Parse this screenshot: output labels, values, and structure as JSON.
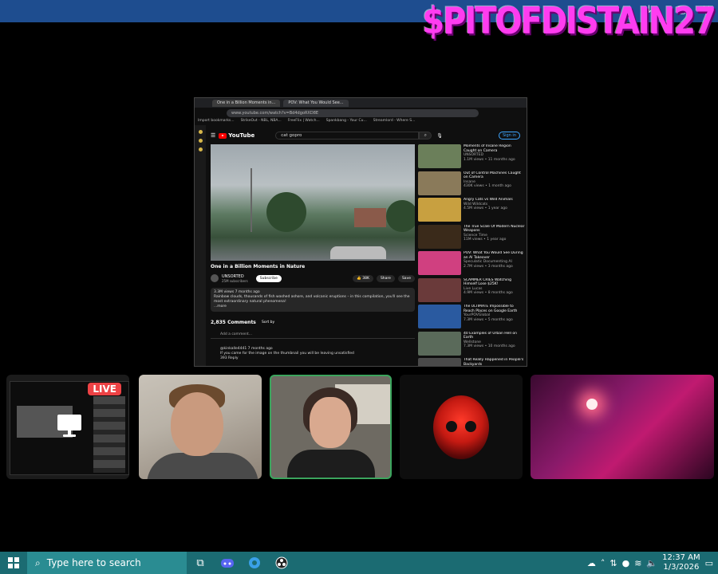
{
  "overlay": {
    "streamer_name": "$PITOFDISTAIN27",
    "live_badge": "LIVE"
  },
  "topbar": {
    "controls": [
      "↓",
      "▢",
      "✕"
    ]
  },
  "browser": {
    "tabs": [
      "One in a Billion Moments in...",
      "POV: What You Would See..."
    ],
    "address": "www.youtube.com/watch?v=Bd4dgoRXD8E",
    "bookmarks": [
      "Import bookmarks...",
      "StrikeOut - NBL, NBA...",
      "FreeFlix | Watch...",
      "Spankbang - Your Cu...",
      "Streamlord - Where S..."
    ]
  },
  "youtube": {
    "logo": "YouTube",
    "search_query": "cat gopro",
    "sign_in": "Sign in",
    "video_title": "One in a Billion Moments in Nature",
    "channel": "UNSORTED",
    "subscribers": "25M subscribers",
    "subscribe": "Subscribe",
    "likes": "38K",
    "share": "Share",
    "save": "Save",
    "desc_stats": "3.3M views  7 months ago",
    "desc_text": "Rainbow clouds, thousands of fish washed ashore, and volcanic eruptions – in this compilation, you'll see the most extraordinary natural phenomena!",
    "desc_more": "...more",
    "comments_count": "2,835 Comments",
    "sort_by": "Sort by",
    "add_comment": "Add a comment...",
    "comment_author": "@kinkalle4441  7 months ago",
    "comment_text": "If you came for the image on the thumbnail you will be leaving unsatisfied",
    "comment_likes": "393",
    "comment_reply": "Reply",
    "recommendations": [
      {
        "title": "Moments of Insane Region Caught on Camera",
        "channel": "UNSORTED",
        "stats": "1.1M views • 11 months ago",
        "color": "#6b7f5a"
      },
      {
        "title": "Out of Control Machines Caught on Camera",
        "channel": "Insane",
        "stats": "430K views • 1 month ago",
        "color": "#8a7a5a"
      },
      {
        "title": "Angry Cats vs Wild Animals",
        "channel": "Wild Wildcats",
        "stats": "4.5M views • 1 year ago",
        "color": "#c8a040"
      },
      {
        "title": "The True Scale Of Modern Nuclear Weapons",
        "channel": "Science Time",
        "stats": "11M views • 1 year ago",
        "color": "#3a2a1a"
      },
      {
        "title": "POV: What You Would See During an AI Takeover",
        "channel": "Speculatic Documenting AI",
        "stats": "2.7M views • 3 months ago",
        "color": "#d04080"
      },
      {
        "title": "SCAMMER CRIES Watching Himself Lose $25K!",
        "channel": "Live Lucas",
        "stats": "4.9M views • 8 months ago",
        "color": "#6a3a3a"
      },
      {
        "title": "The ULTIMATE Impossible to Reach Places on Google Earth",
        "channel": "YourPOVGlobal",
        "stats": "7.3M views • 5 months ago",
        "color": "#2a5aa0"
      },
      {
        "title": "40 Examples of Urban Hell on Earth",
        "channel": "Wellstone",
        "stats": "7.3M views • 10 months ago",
        "color": "#5a6a5a"
      },
      {
        "title": "That Really Happened in People's Backyards",
        "channel": "",
        "stats": "",
        "color": "#4a4a4a"
      }
    ]
  },
  "taskbar": {
    "search_placeholder": "Type here to search",
    "time": "12:37 AM",
    "date": "1/3/2026"
  }
}
